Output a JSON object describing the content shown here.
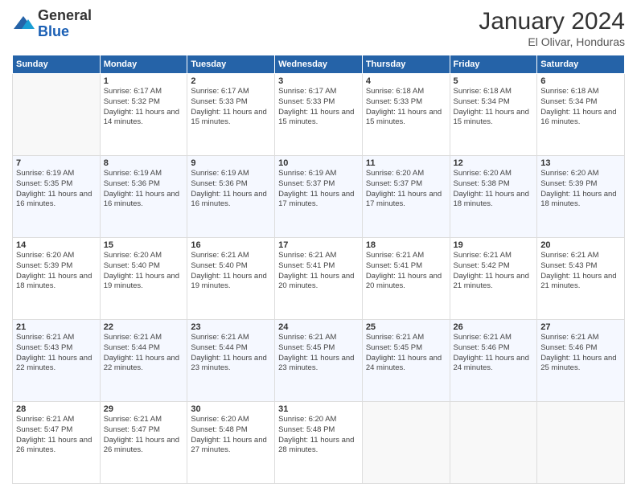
{
  "logo": {
    "general": "General",
    "blue": "Blue"
  },
  "header": {
    "month": "January 2024",
    "location": "El Olivar, Honduras"
  },
  "days_of_week": [
    "Sunday",
    "Monday",
    "Tuesday",
    "Wednesday",
    "Thursday",
    "Friday",
    "Saturday"
  ],
  "weeks": [
    [
      {
        "day": "",
        "empty": true
      },
      {
        "day": "1",
        "sunrise": "Sunrise: 6:17 AM",
        "sunset": "Sunset: 5:32 PM",
        "daylight": "Daylight: 11 hours and 14 minutes."
      },
      {
        "day": "2",
        "sunrise": "Sunrise: 6:17 AM",
        "sunset": "Sunset: 5:33 PM",
        "daylight": "Daylight: 11 hours and 15 minutes."
      },
      {
        "day": "3",
        "sunrise": "Sunrise: 6:17 AM",
        "sunset": "Sunset: 5:33 PM",
        "daylight": "Daylight: 11 hours and 15 minutes."
      },
      {
        "day": "4",
        "sunrise": "Sunrise: 6:18 AM",
        "sunset": "Sunset: 5:33 PM",
        "daylight": "Daylight: 11 hours and 15 minutes."
      },
      {
        "day": "5",
        "sunrise": "Sunrise: 6:18 AM",
        "sunset": "Sunset: 5:34 PM",
        "daylight": "Daylight: 11 hours and 15 minutes."
      },
      {
        "day": "6",
        "sunrise": "Sunrise: 6:18 AM",
        "sunset": "Sunset: 5:34 PM",
        "daylight": "Daylight: 11 hours and 16 minutes."
      }
    ],
    [
      {
        "day": "7",
        "sunrise": "Sunrise: 6:19 AM",
        "sunset": "Sunset: 5:35 PM",
        "daylight": "Daylight: 11 hours and 16 minutes."
      },
      {
        "day": "8",
        "sunrise": "Sunrise: 6:19 AM",
        "sunset": "Sunset: 5:36 PM",
        "daylight": "Daylight: 11 hours and 16 minutes."
      },
      {
        "day": "9",
        "sunrise": "Sunrise: 6:19 AM",
        "sunset": "Sunset: 5:36 PM",
        "daylight": "Daylight: 11 hours and 16 minutes."
      },
      {
        "day": "10",
        "sunrise": "Sunrise: 6:19 AM",
        "sunset": "Sunset: 5:37 PM",
        "daylight": "Daylight: 11 hours and 17 minutes."
      },
      {
        "day": "11",
        "sunrise": "Sunrise: 6:20 AM",
        "sunset": "Sunset: 5:37 PM",
        "daylight": "Daylight: 11 hours and 17 minutes."
      },
      {
        "day": "12",
        "sunrise": "Sunrise: 6:20 AM",
        "sunset": "Sunset: 5:38 PM",
        "daylight": "Daylight: 11 hours and 18 minutes."
      },
      {
        "day": "13",
        "sunrise": "Sunrise: 6:20 AM",
        "sunset": "Sunset: 5:39 PM",
        "daylight": "Daylight: 11 hours and 18 minutes."
      }
    ],
    [
      {
        "day": "14",
        "sunrise": "Sunrise: 6:20 AM",
        "sunset": "Sunset: 5:39 PM",
        "daylight": "Daylight: 11 hours and 18 minutes."
      },
      {
        "day": "15",
        "sunrise": "Sunrise: 6:20 AM",
        "sunset": "Sunset: 5:40 PM",
        "daylight": "Daylight: 11 hours and 19 minutes."
      },
      {
        "day": "16",
        "sunrise": "Sunrise: 6:21 AM",
        "sunset": "Sunset: 5:40 PM",
        "daylight": "Daylight: 11 hours and 19 minutes."
      },
      {
        "day": "17",
        "sunrise": "Sunrise: 6:21 AM",
        "sunset": "Sunset: 5:41 PM",
        "daylight": "Daylight: 11 hours and 20 minutes."
      },
      {
        "day": "18",
        "sunrise": "Sunrise: 6:21 AM",
        "sunset": "Sunset: 5:41 PM",
        "daylight": "Daylight: 11 hours and 20 minutes."
      },
      {
        "day": "19",
        "sunrise": "Sunrise: 6:21 AM",
        "sunset": "Sunset: 5:42 PM",
        "daylight": "Daylight: 11 hours and 21 minutes."
      },
      {
        "day": "20",
        "sunrise": "Sunrise: 6:21 AM",
        "sunset": "Sunset: 5:43 PM",
        "daylight": "Daylight: 11 hours and 21 minutes."
      }
    ],
    [
      {
        "day": "21",
        "sunrise": "Sunrise: 6:21 AM",
        "sunset": "Sunset: 5:43 PM",
        "daylight": "Daylight: 11 hours and 22 minutes."
      },
      {
        "day": "22",
        "sunrise": "Sunrise: 6:21 AM",
        "sunset": "Sunset: 5:44 PM",
        "daylight": "Daylight: 11 hours and 22 minutes."
      },
      {
        "day": "23",
        "sunrise": "Sunrise: 6:21 AM",
        "sunset": "Sunset: 5:44 PM",
        "daylight": "Daylight: 11 hours and 23 minutes."
      },
      {
        "day": "24",
        "sunrise": "Sunrise: 6:21 AM",
        "sunset": "Sunset: 5:45 PM",
        "daylight": "Daylight: 11 hours and 23 minutes."
      },
      {
        "day": "25",
        "sunrise": "Sunrise: 6:21 AM",
        "sunset": "Sunset: 5:45 PM",
        "daylight": "Daylight: 11 hours and 24 minutes."
      },
      {
        "day": "26",
        "sunrise": "Sunrise: 6:21 AM",
        "sunset": "Sunset: 5:46 PM",
        "daylight": "Daylight: 11 hours and 24 minutes."
      },
      {
        "day": "27",
        "sunrise": "Sunrise: 6:21 AM",
        "sunset": "Sunset: 5:46 PM",
        "daylight": "Daylight: 11 hours and 25 minutes."
      }
    ],
    [
      {
        "day": "28",
        "sunrise": "Sunrise: 6:21 AM",
        "sunset": "Sunset: 5:47 PM",
        "daylight": "Daylight: 11 hours and 26 minutes."
      },
      {
        "day": "29",
        "sunrise": "Sunrise: 6:21 AM",
        "sunset": "Sunset: 5:47 PM",
        "daylight": "Daylight: 11 hours and 26 minutes."
      },
      {
        "day": "30",
        "sunrise": "Sunrise: 6:20 AM",
        "sunset": "Sunset: 5:48 PM",
        "daylight": "Daylight: 11 hours and 27 minutes."
      },
      {
        "day": "31",
        "sunrise": "Sunrise: 6:20 AM",
        "sunset": "Sunset: 5:48 PM",
        "daylight": "Daylight: 11 hours and 28 minutes."
      },
      {
        "day": "",
        "empty": true
      },
      {
        "day": "",
        "empty": true
      },
      {
        "day": "",
        "empty": true
      }
    ]
  ]
}
